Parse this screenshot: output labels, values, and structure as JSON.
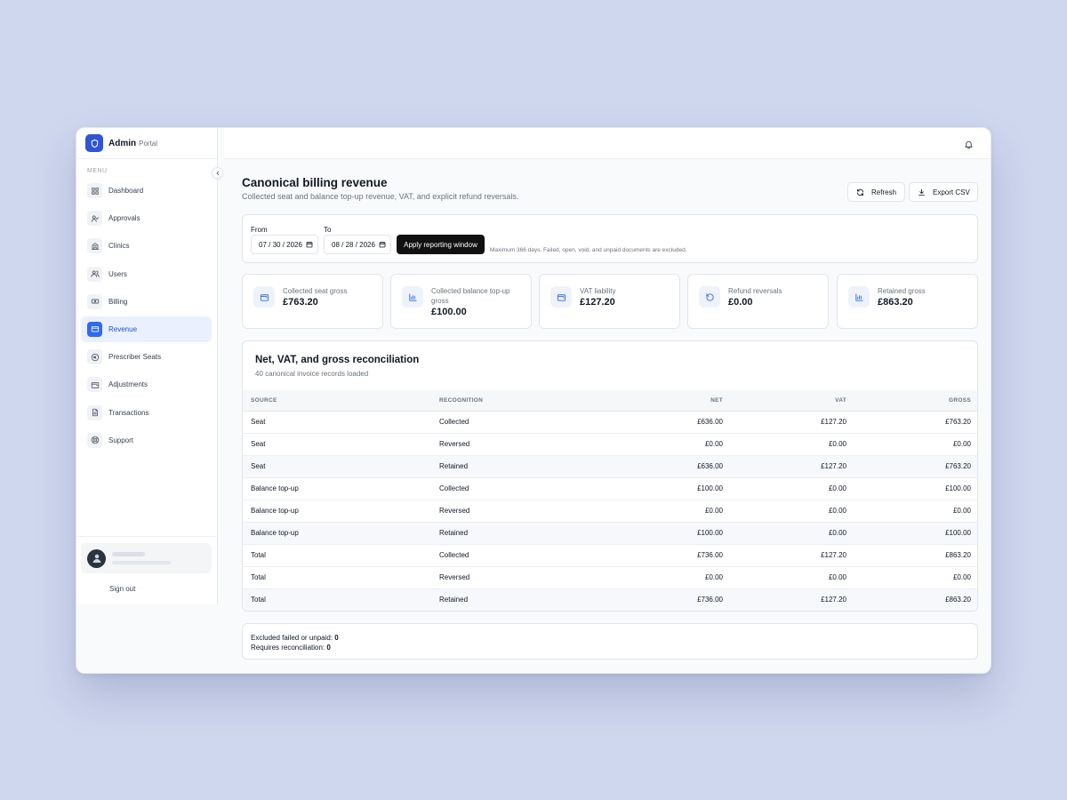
{
  "brand": {
    "name": "Admin",
    "sub": "Portal"
  },
  "sidebar": {
    "menu_label": "MENU",
    "items": [
      {
        "label": "Dashboard",
        "icon": "dashboard-icon"
      },
      {
        "label": "Approvals",
        "icon": "user-check-icon"
      },
      {
        "label": "Clinics",
        "icon": "building-icon"
      },
      {
        "label": "Users",
        "icon": "users-icon"
      },
      {
        "label": "Billing",
        "icon": "billing-icon"
      },
      {
        "label": "Revenue",
        "icon": "credit-card-icon",
        "active": true
      },
      {
        "label": "Prescriber Seats",
        "icon": "seat-icon"
      },
      {
        "label": "Adjustments",
        "icon": "wallet-icon"
      },
      {
        "label": "Transactions",
        "icon": "document-icon"
      },
      {
        "label": "Support",
        "icon": "support-icon"
      }
    ],
    "sign_out": "Sign out"
  },
  "header": {
    "title": "Canonical billing revenue",
    "subtitle": "Collected seat and balance top-up revenue, VAT, and explicit refund reversals.",
    "refresh_label": "Refresh",
    "export_label": "Export CSV"
  },
  "filter": {
    "from_label": "From",
    "to_label": "To",
    "from_value": "07 / 30 / 2026",
    "to_value": "08 / 28 / 2026",
    "apply_label": "Apply reporting window",
    "note": "Maximum 366 days. Failed, open, void, and unpaid documents are excluded."
  },
  "stats": [
    {
      "label": "Collected seat gross",
      "value": "£763.20",
      "icon": "wallet-icon"
    },
    {
      "label": "Collected balance top-up gross",
      "value": "£100.00",
      "icon": "bar-chart-icon"
    },
    {
      "label": "VAT liability",
      "value": "£127.20",
      "icon": "wallet-icon"
    },
    {
      "label": "Refund reversals",
      "value": "£0.00",
      "icon": "undo-icon"
    },
    {
      "label": "Retained gross",
      "value": "£863.20",
      "icon": "bar-chart-icon"
    }
  ],
  "reconciliation": {
    "title": "Net, VAT, and gross reconciliation",
    "subtitle": "40 canonical invoice records loaded",
    "columns": [
      "SOURCE",
      "RECOGNITION",
      "NET",
      "VAT",
      "GROSS"
    ],
    "rows": [
      [
        "Seat",
        "Collected",
        "£636.00",
        "£127.20",
        "£763.20"
      ],
      [
        "Seat",
        "Reversed",
        "£0.00",
        "£0.00",
        "£0.00"
      ],
      [
        "Seat",
        "Retained",
        "£636.00",
        "£127.20",
        "£763.20"
      ],
      [
        "Balance top-up",
        "Collected",
        "£100.00",
        "£0.00",
        "£100.00"
      ],
      [
        "Balance top-up",
        "Reversed",
        "£0.00",
        "£0.00",
        "£0.00"
      ],
      [
        "Balance top-up",
        "Retained",
        "£100.00",
        "£0.00",
        "£100.00"
      ],
      [
        "Total",
        "Collected",
        "£736.00",
        "£127.20",
        "£863.20"
      ],
      [
        "Total",
        "Reversed",
        "£0.00",
        "£0.00",
        "£0.00"
      ],
      [
        "Total",
        "Retained",
        "£736.00",
        "£127.20",
        "£863.20"
      ]
    ]
  },
  "footer": {
    "excluded_label": "Excluded failed or unpaid:",
    "excluded_value": "0",
    "reconcile_label": "Requires reconciliation:",
    "reconcile_value": "0"
  },
  "colors": {
    "accent": "#2f6bf0",
    "brand": "#2f55d4",
    "apply_button": "#111111"
  }
}
